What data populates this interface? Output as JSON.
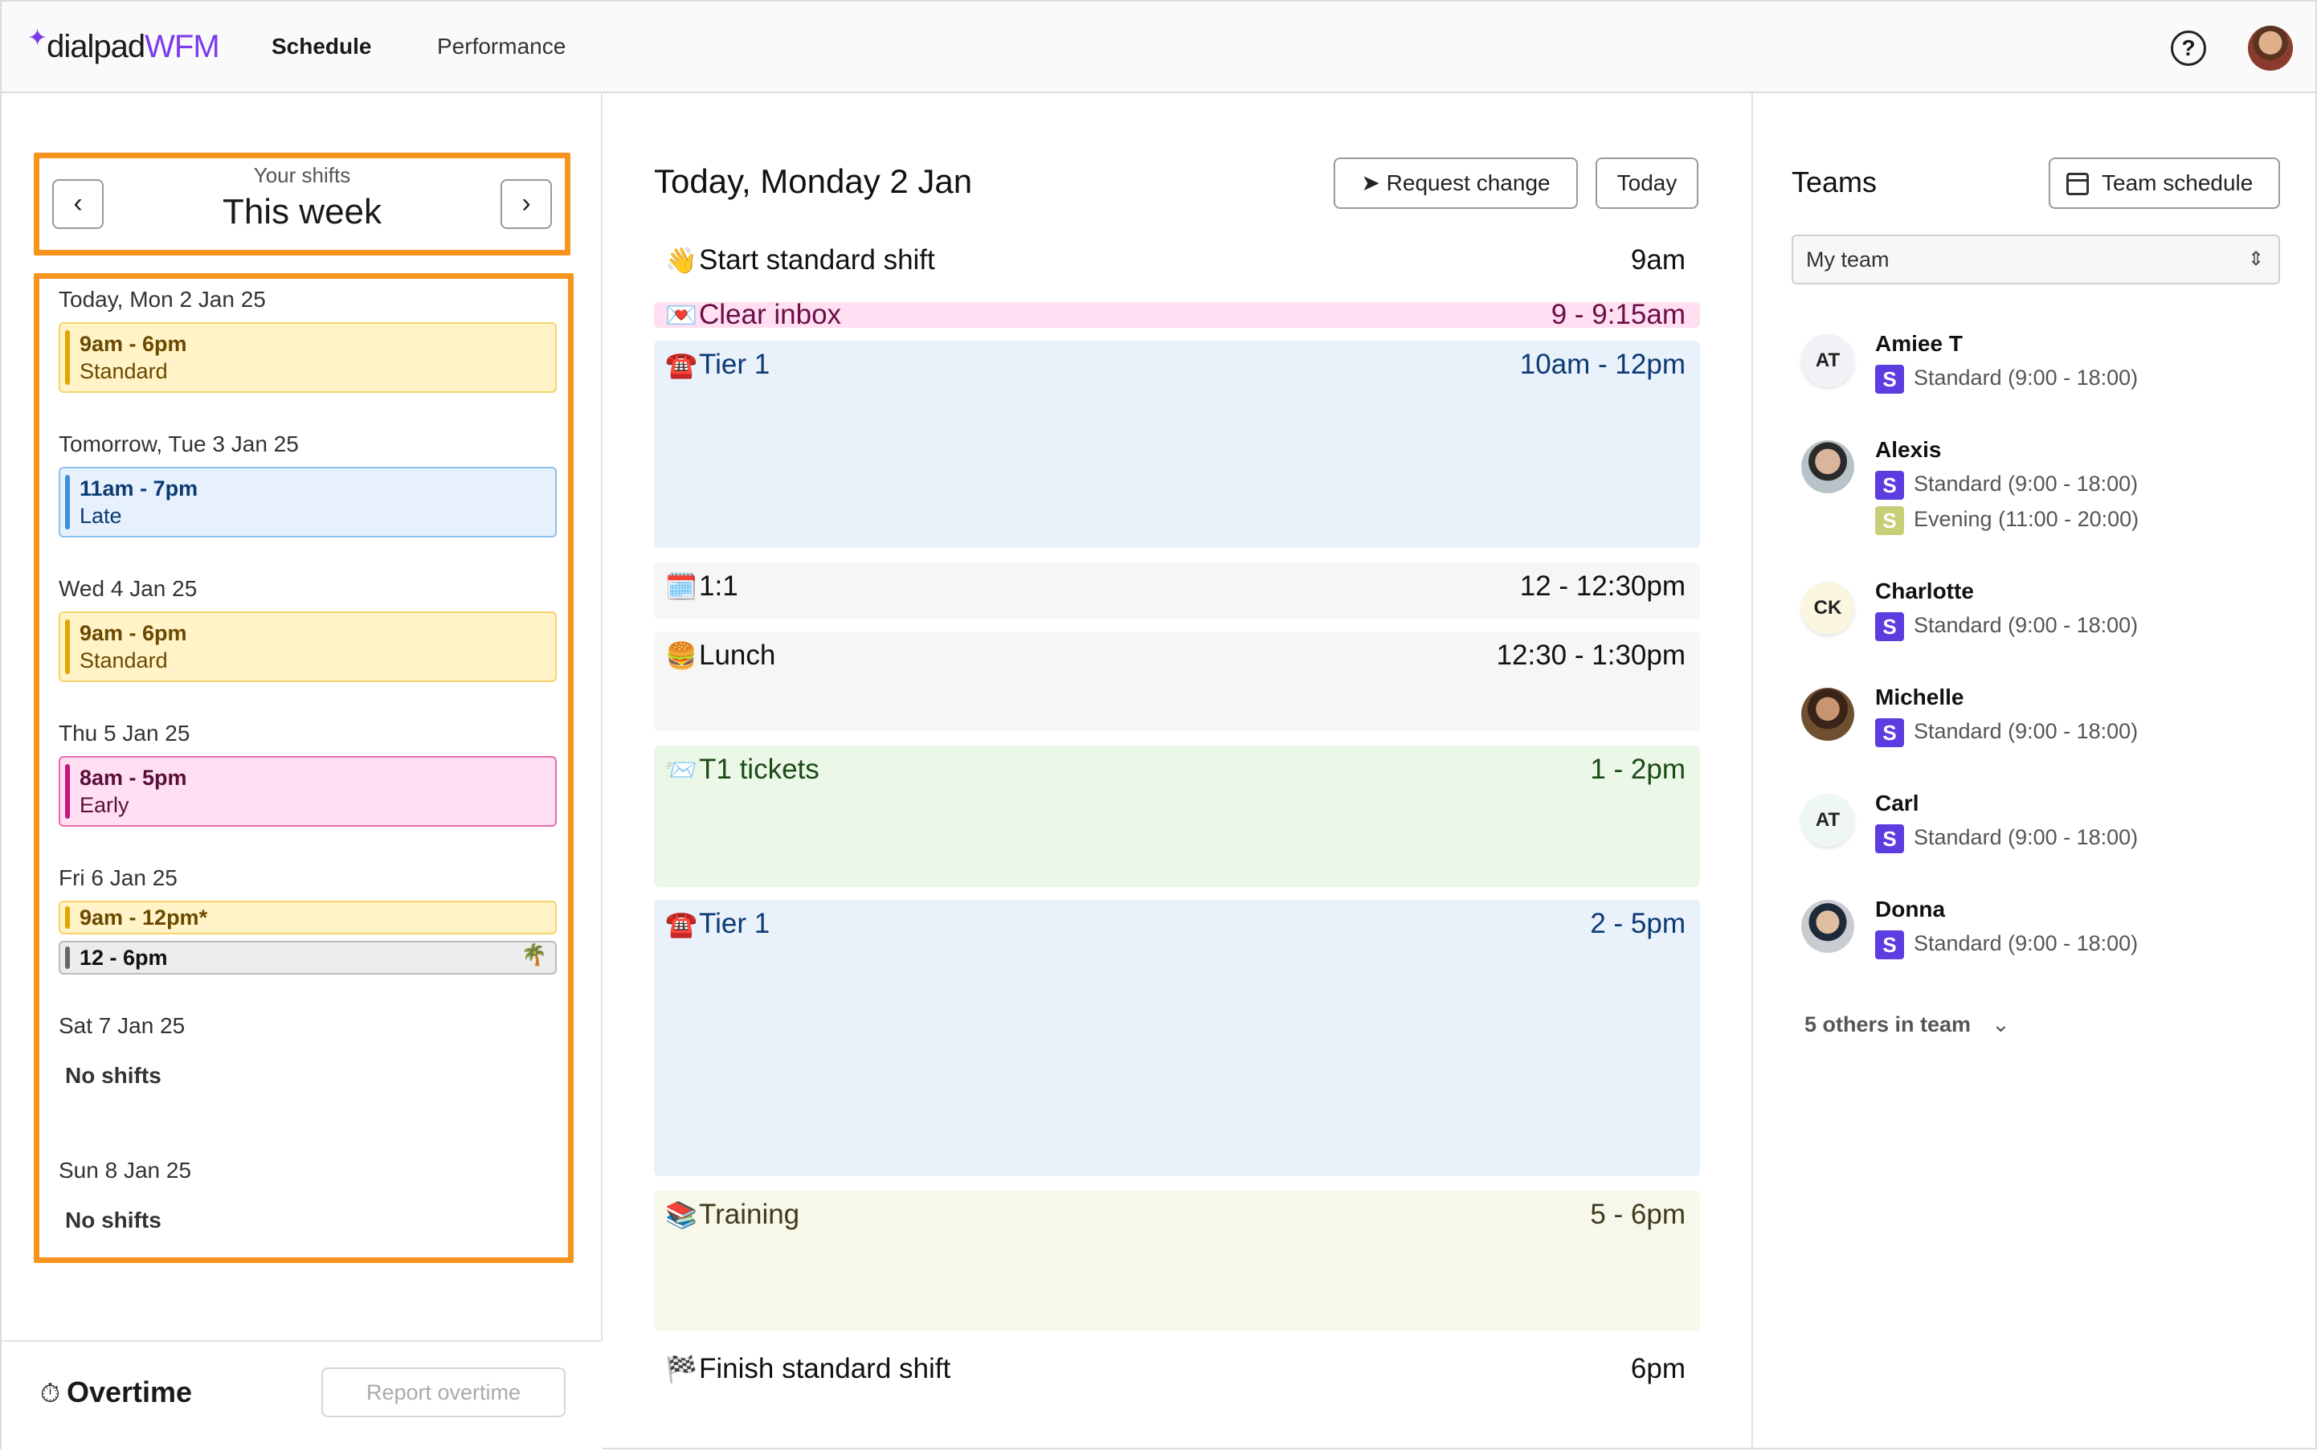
{
  "header": {
    "logo_spark": "✦",
    "logo_brand": "dialpad",
    "logo_product": "WFM",
    "nav": [
      "Schedule",
      "Performance"
    ],
    "help_label": "?"
  },
  "week_nav": {
    "subtitle": "Your shifts",
    "title": "This week",
    "prev": "‹",
    "next": "›"
  },
  "days": [
    {
      "label": "Today, Mon 2 Jan 25",
      "shifts": [
        {
          "time": "9am - 6pm",
          "kind": "Standard",
          "color": "yellow"
        }
      ]
    },
    {
      "label": "Tomorrow, Tue 3 Jan 25",
      "shifts": [
        {
          "time": "11am - 7pm",
          "kind": "Late",
          "color": "blue"
        }
      ]
    },
    {
      "label": "Wed 4 Jan 25",
      "shifts": [
        {
          "time": "9am - 6pm",
          "kind": "Standard",
          "color": "yellow"
        }
      ]
    },
    {
      "label": "Thu 5 Jan 25",
      "shifts": [
        {
          "time": "8am - 5pm",
          "kind": "Early",
          "color": "pink"
        }
      ]
    },
    {
      "label": "Fri 6 Jan 25",
      "shifts": [
        {
          "time": "9am - 12pm*",
          "color": "yellow"
        },
        {
          "time": "12 - 6pm",
          "color": "gray",
          "icon": "🌴"
        }
      ]
    },
    {
      "label": "Sat 7 Jan 25",
      "no_shifts": "No shifts"
    },
    {
      "label": "Sun 8 Jan 25",
      "no_shifts": "No shifts"
    }
  ],
  "overtime": {
    "icon": "⏱",
    "title": "Overtime",
    "button": "Report overtime"
  },
  "today": {
    "title": "Today, Monday 2 Jan",
    "request_button": "Request change",
    "today_button": "Today",
    "activities": [
      {
        "emoji": "👋",
        "name": "Start standard shift",
        "time": "9am"
      },
      {
        "emoji": "💌",
        "name": "Clear inbox",
        "time": "9 - 9:15am"
      },
      {
        "emoji": "☎️",
        "name": "Tier 1",
        "time": "10am - 12pm"
      },
      {
        "emoji": "🗓️",
        "name": "1:1",
        "time": "12 - 12:30pm"
      },
      {
        "emoji": "🍔",
        "name": "Lunch",
        "time": "12:30 - 1:30pm"
      },
      {
        "emoji": "📨",
        "name": "T1 tickets",
        "time": "1 - 2pm"
      },
      {
        "emoji": "☎️",
        "name": "Tier 1",
        "time": "2 - 5pm"
      },
      {
        "emoji": "📚",
        "name": "Training",
        "time": "5 - 6pm"
      },
      {
        "emoji": "🏁",
        "name": "Finish standard shift",
        "time": "6pm"
      }
    ]
  },
  "teams": {
    "title": "Teams",
    "team_schedule_button": "Team schedule",
    "select_value": "My team",
    "members": [
      {
        "initials": "AT",
        "name": "Amiee T",
        "shifts": [
          {
            "badge": "S",
            "text": "Standard (9:00 - 18:00)"
          }
        ]
      },
      {
        "initials": "",
        "name": "Alexis",
        "shifts": [
          {
            "badge": "S",
            "text": "Standard (9:00 - 18:00)"
          },
          {
            "badge": "S",
            "text": "Evening (11:00 - 20:00)"
          }
        ]
      },
      {
        "initials": "CK",
        "name": "Charlotte",
        "shifts": [
          {
            "badge": "S",
            "text": "Standard (9:00 - 18:00)"
          }
        ]
      },
      {
        "initials": "",
        "name": "Michelle",
        "shifts": [
          {
            "badge": "S",
            "text": "Standard (9:00 - 18:00)"
          }
        ]
      },
      {
        "initials": "AT",
        "name": "Carl",
        "shifts": [
          {
            "badge": "S",
            "text": "Standard (9:00 - 18:00)"
          }
        ]
      },
      {
        "initials": "",
        "name": "Donna",
        "shifts": [
          {
            "badge": "S",
            "text": "Standard (9:00 - 18:00)"
          }
        ]
      }
    ],
    "others": "5 others in team",
    "others_chevron": "⌄"
  },
  "colors": {
    "accent": "#7c3aed",
    "highlight_border": "#f7941d",
    "badge_standard": "#5b3de0",
    "badge_evening": "#c7cf79"
  }
}
